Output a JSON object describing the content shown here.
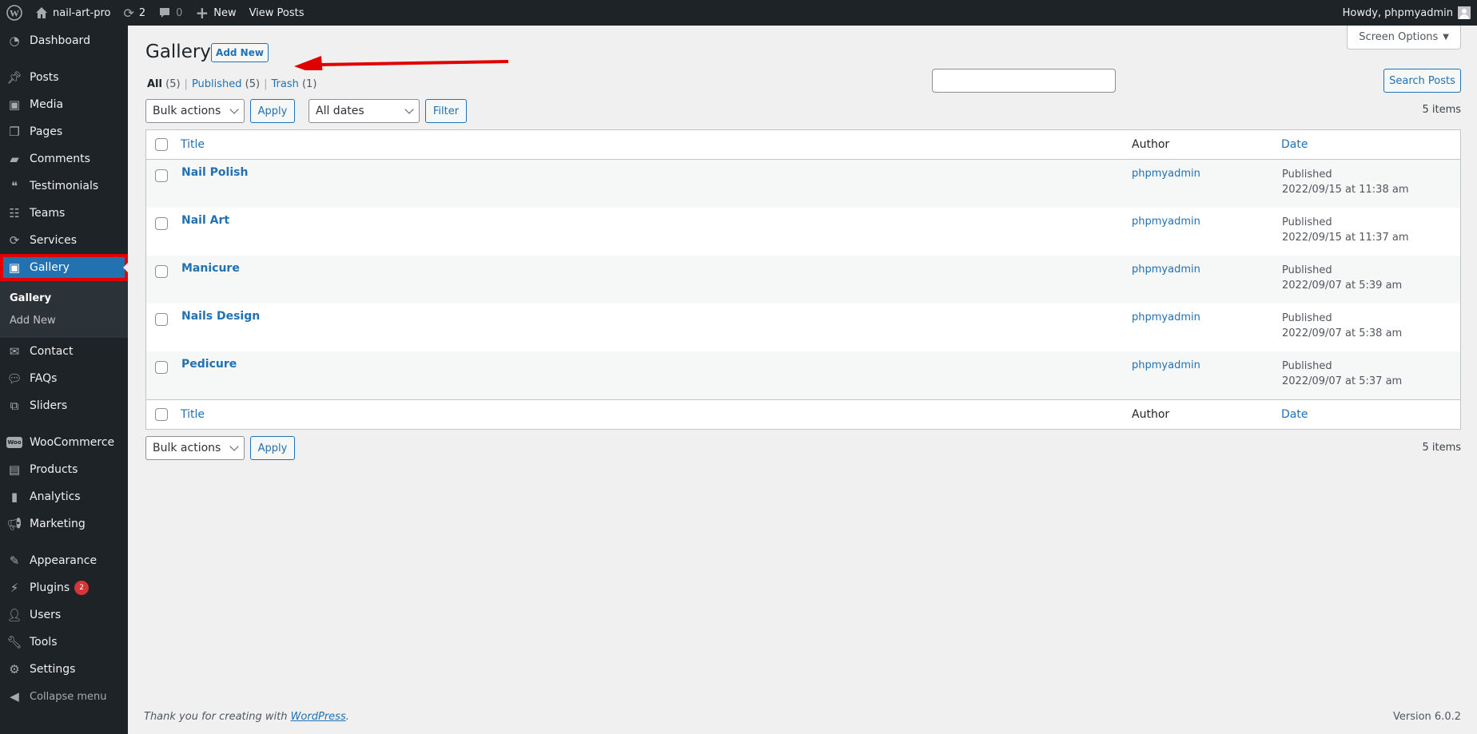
{
  "admin_bar": {
    "site_name": "nail-art-pro",
    "updates_count": "2",
    "comments_count": "0",
    "new_label": "New",
    "view_posts_label": "View Posts",
    "greeting": "Howdy, phpmyadmin"
  },
  "sidebar": {
    "items": [
      {
        "label": "Dashboard",
        "icon": "dashboard-icon"
      },
      {
        "label": "Posts",
        "icon": "pin-icon"
      },
      {
        "label": "Media",
        "icon": "media-icon"
      },
      {
        "label": "Pages",
        "icon": "pages-icon"
      },
      {
        "label": "Comments",
        "icon": "comment-icon"
      },
      {
        "label": "Testimonials",
        "icon": "testimonials-icon"
      },
      {
        "label": "Teams",
        "icon": "groups-icon"
      },
      {
        "label": "Services",
        "icon": "update-icon"
      },
      {
        "label": "Gallery",
        "icon": "media-icon"
      },
      {
        "label": "Contact",
        "icon": "email-icon"
      },
      {
        "label": "FAQs",
        "icon": "chat-bubble-icon"
      },
      {
        "label": "Sliders",
        "icon": "images-icon"
      },
      {
        "label": "WooCommerce",
        "icon": "woo-icon"
      },
      {
        "label": "Products",
        "icon": "archive-icon"
      },
      {
        "label": "Analytics",
        "icon": "bar-chart-icon"
      },
      {
        "label": "Marketing",
        "icon": "megaphone-icon"
      },
      {
        "label": "Appearance",
        "icon": "paintbrush-icon"
      },
      {
        "label": "Plugins",
        "icon": "plugin-icon",
        "badge": "2"
      },
      {
        "label": "Users",
        "icon": "user-icon"
      },
      {
        "label": "Tools",
        "icon": "wrench-icon"
      },
      {
        "label": "Settings",
        "icon": "settings-icon"
      }
    ],
    "submenu": {
      "current": "Gallery",
      "add_new": "Add New"
    },
    "collapse_label": "Collapse menu"
  },
  "screen_options_label": "Screen Options",
  "page": {
    "title": "Gallery",
    "add_new_label": "Add New"
  },
  "filters": {
    "all_label": "All",
    "all_count": "(5)",
    "published_label": "Published",
    "published_count": "(5)",
    "trash_label": "Trash",
    "trash_count": "(1)",
    "bulk_actions": "Bulk actions",
    "apply_label": "Apply",
    "dates": "All dates",
    "filter_label": "Filter",
    "search_value": "",
    "search_button": "Search Posts",
    "item_count": "5 items"
  },
  "table": {
    "columns": {
      "title": "Title",
      "author": "Author",
      "date": "Date"
    },
    "rows": [
      {
        "title": "Nail Polish",
        "author": "phpmyadmin",
        "status": "Published",
        "date": "2022/09/15 at 11:38 am"
      },
      {
        "title": "Nail Art",
        "author": "phpmyadmin",
        "status": "Published",
        "date": "2022/09/15 at 11:37 am"
      },
      {
        "title": "Manicure",
        "author": "phpmyadmin",
        "status": "Published",
        "date": "2022/09/07 at 5:39 am"
      },
      {
        "title": "Nails Design",
        "author": "phpmyadmin",
        "status": "Published",
        "date": "2022/09/07 at 5:38 am"
      },
      {
        "title": "Pedicure",
        "author": "phpmyadmin",
        "status": "Published",
        "date": "2022/09/07 at 5:37 am"
      }
    ]
  },
  "footer": {
    "thanks_prefix": "Thank you for creating with ",
    "wordpress_link": "WordPress",
    "thanks_suffix": ".",
    "version": "Version 6.0.2"
  },
  "colors": {
    "accent": "#2271b1",
    "highlight_border": "#e00000",
    "sidebar_bg": "#1d2327",
    "badge": "#d63638"
  }
}
